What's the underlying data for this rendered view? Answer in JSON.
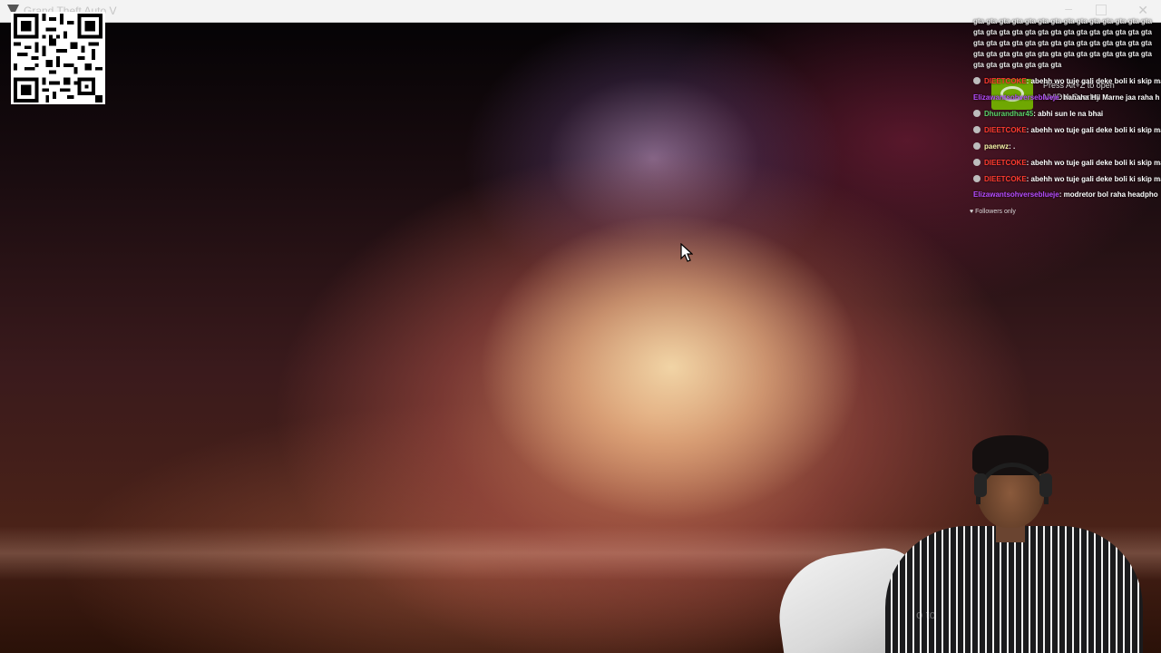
{
  "window": {
    "title": "Grand Theft Auto V",
    "icon": "gta-app-icon",
    "controls": [
      "minimize-icon",
      "maximize-icon",
      "close-icon"
    ]
  },
  "overlay": {
    "qr_code": "qr-code",
    "nvidia_overlay": {
      "line1": "Press Alt+Z to open",
      "line2": "NVIDIA Overlay"
    }
  },
  "chat": {
    "spam_line": "gta gta gta gta gta gta gta gta gta gta gta gta gta gta gta gta gta gta gta gta gta gta gta gta gta gta gta gta gta gta gta gta gta gta gta gta gta gta gta gta gta gta gta gta gta gta gta gta gta gta gta gta gta gta gta gta gta gta gta gta gta gta gta",
    "messages": [
      {
        "user": "DIEETCOKE",
        "text": ": abehh wo tuje gali deke boli ki skip mar"
      },
      {
        "user": "Elizawantsohverseblueje",
        "text": ": hahaha Hii Marne jaa raha h"
      },
      {
        "user": "Dhurandhar45",
        "text": ": abhi sun le na bhai"
      },
      {
        "user": "DIEETCOKE",
        "text": ": abehh wo tuje gali deke boli ki skip mar"
      },
      {
        "user": "paerwz",
        "text": ": ."
      },
      {
        "user": "DIEETCOKE",
        "text": ": abehh wo tuje gali deke boli ki skip mar"
      },
      {
        "user": "DIEETCOKE",
        "text": ": abehh wo tuje gali deke boli ki skip mar"
      },
      {
        "user": "Elizawantsohverseblueje",
        "text": ": modretor bol raha headpho"
      }
    ],
    "followers_only": "Followers only"
  },
  "webcam": {
    "subtitle": "o to"
  },
  "colors": {
    "user_red": "#ff3b2f",
    "user_purple": "#b64cff",
    "user_green": "#5bd46a",
    "user_yellow": "#f7f2a8",
    "nvidia_green": "#76b900"
  }
}
